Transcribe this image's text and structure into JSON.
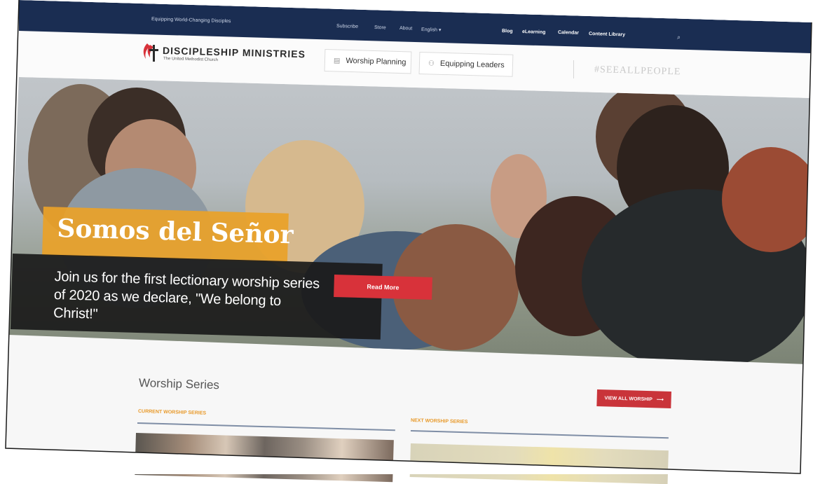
{
  "topbar": {
    "tagline": "Equipping World-Changing Disciples",
    "links": [
      "Subscribe",
      "Store",
      "About",
      "English ▾"
    ],
    "bold_links": [
      "Blog",
      "eLearning",
      "Calendar",
      "Content Library"
    ],
    "search_icon": "search-icon"
  },
  "header": {
    "logo_title": "DISCIPLESHIP MINISTRIES",
    "logo_subtitle": "The United Methodist Church",
    "nav": [
      {
        "label": "Worship Planning",
        "icon": "calendar-icon"
      },
      {
        "label": "Equipping Leaders",
        "icon": "people-icon"
      }
    ],
    "hashtag": "#SEEALLPEOPLE"
  },
  "hero": {
    "title": "Somos del Señor",
    "text": "Join us for the first lectionary worship series of 2020 as we declare, \"We belong to Christ!\"",
    "button_label": "Read More"
  },
  "worship": {
    "section_title": "Worship Series",
    "view_all_label": "VIEW ALL WORSHIP",
    "current_label": "CURRENT WORSHIP SERIES",
    "next_label": "NEXT WORSHIP SERIES"
  },
  "colors": {
    "navy": "#1a2d52",
    "orange": "#e9a129",
    "red": "#d8323a"
  }
}
